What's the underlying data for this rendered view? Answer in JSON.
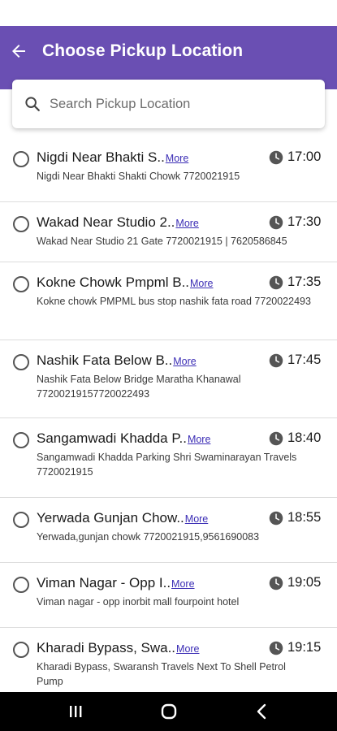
{
  "header": {
    "title": "Choose Pickup Location"
  },
  "search": {
    "placeholder": "Search Pickup Location"
  },
  "more_label": "More",
  "colors": {
    "app_bar": "#6a4fb3",
    "more_link": "#3b2db5",
    "nav_bar": "#000000"
  },
  "icons": {
    "back": "arrow-left-icon",
    "search": "search-icon",
    "clock": "clock-icon",
    "radio": "radio-unchecked-icon",
    "nav_recent": "recent-apps-icon",
    "nav_home": "home-icon",
    "nav_back": "chevron-left-icon"
  },
  "locations": [
    {
      "title": "Nigdi Near Bhakti S..",
      "time": "17:00",
      "subtitle": "Nigdi Near Bhakti Shakti Chowk 7720021915"
    },
    {
      "title": "Wakad Near Studio 2..",
      "time": "17:30",
      "subtitle": "Wakad Near Studio 21 Gate 7720021915 | 7620586845"
    },
    {
      "title": "Kokne Chowk Pmpml B..",
      "time": "17:35",
      "subtitle": "Kokne chowk PMPML bus stop nashik fata road 7720022493"
    },
    {
      "title": "Nashik Fata Below B..",
      "time": "17:45",
      "subtitle": "Nashik Fata Below Bridge Maratha Khanawal 77200219157720022493"
    },
    {
      "title": "Sangamwadi Khadda P..",
      "time": "18:40",
      "subtitle": "Sangamwadi Khadda Parking Shri Swaminarayan Travels 7720021915"
    },
    {
      "title": "Yerwada Gunjan Chow..",
      "time": "18:55",
      "subtitle": "Yerwada,gunjan chowk 7720021915,9561690083"
    },
    {
      "title": "Viman Nagar - Opp I..",
      "time": "19:05",
      "subtitle": "Viman nagar - opp inorbit mall fourpoint hotel"
    },
    {
      "title": "Kharadi Bypass, Swa..",
      "time": "19:15",
      "subtitle": "Kharadi Bypass, Swaransh Travels Next To Shell Petrol Pump"
    }
  ]
}
